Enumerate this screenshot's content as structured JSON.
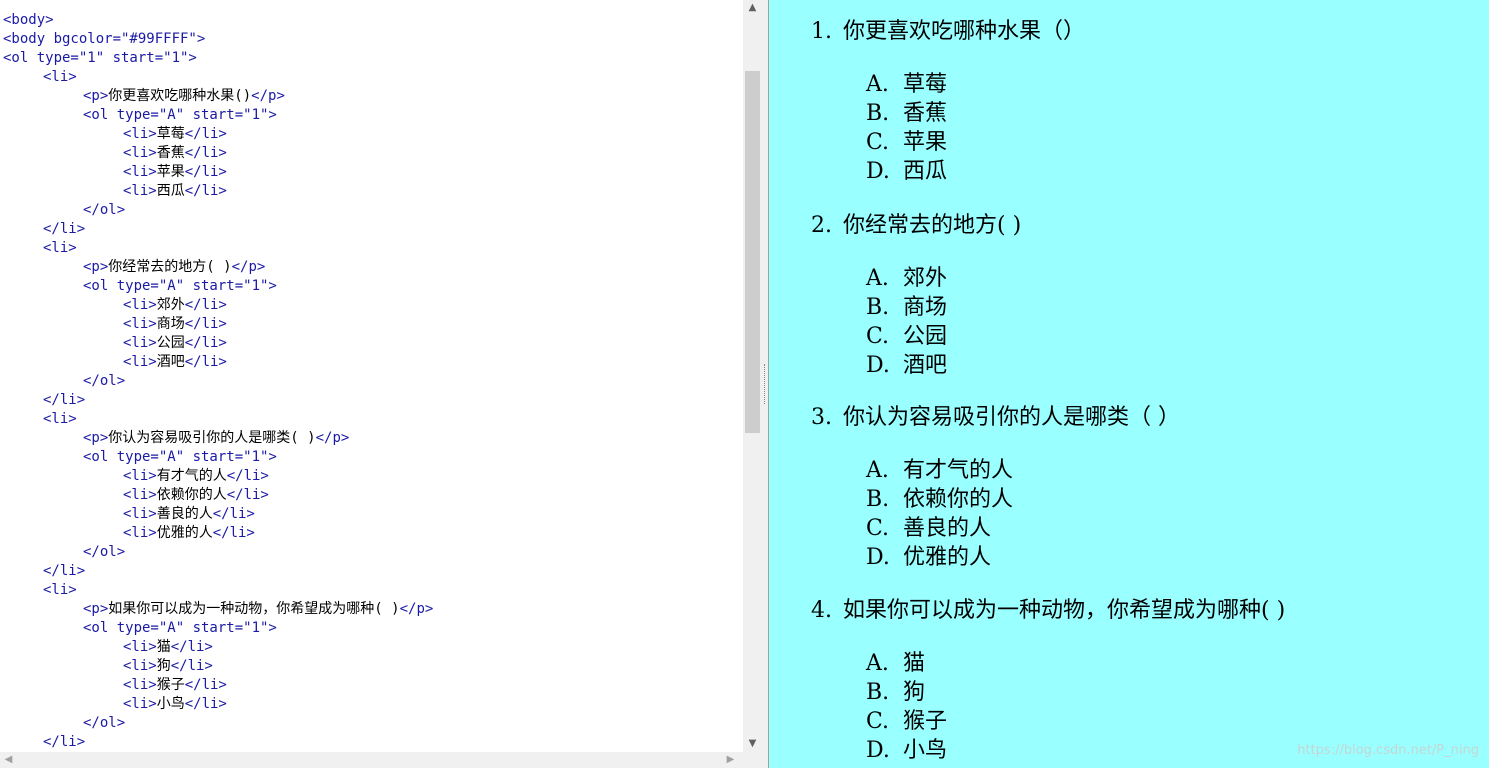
{
  "code": {
    "lines": [
      {
        "indent": 0,
        "text": "<body>"
      },
      {
        "indent": 0,
        "text": "<body bgcolor=\"#99FFFF\">"
      },
      {
        "indent": 0,
        "text": "<ol type=\"1\" start=\"1\">"
      },
      {
        "indent": 1,
        "text": "<li>"
      },
      {
        "indent": 2,
        "pre": "<p>",
        "content": "你更喜欢吃哪种水果()",
        "post": "</p>"
      },
      {
        "indent": 2,
        "text": "<ol type=\"A\" start=\"1\">"
      },
      {
        "indent": 3,
        "pre": "<li>",
        "content": "草莓",
        "post": "</li>"
      },
      {
        "indent": 3,
        "pre": "<li>",
        "content": "香蕉",
        "post": "</li>"
      },
      {
        "indent": 3,
        "pre": "<li>",
        "content": "苹果",
        "post": "</li>"
      },
      {
        "indent": 3,
        "pre": "<li>",
        "content": "西瓜",
        "post": "</li>"
      },
      {
        "indent": 2,
        "text": "</ol>"
      },
      {
        "indent": 1,
        "text": "</li>"
      },
      {
        "indent": 1,
        "text": "<li>"
      },
      {
        "indent": 2,
        "pre": "<p>",
        "content": "你经常去的地方( )",
        "post": "</p>"
      },
      {
        "indent": 2,
        "text": "<ol type=\"A\" start=\"1\">"
      },
      {
        "indent": 3,
        "pre": "<li>",
        "content": "郊外",
        "post": "</li>"
      },
      {
        "indent": 3,
        "pre": "<li>",
        "content": "商场",
        "post": "</li>"
      },
      {
        "indent": 3,
        "pre": "<li>",
        "content": "公园",
        "post": "</li>"
      },
      {
        "indent": 3,
        "pre": "<li>",
        "content": "酒吧",
        "post": "</li>"
      },
      {
        "indent": 2,
        "text": "</ol>"
      },
      {
        "indent": 1,
        "text": "</li>"
      },
      {
        "indent": 1,
        "text": "<li>"
      },
      {
        "indent": 2,
        "pre": "<p>",
        "content": "你认为容易吸引你的人是哪类( )",
        "post": "</p>"
      },
      {
        "indent": 2,
        "text": "<ol type=\"A\" start=\"1\">"
      },
      {
        "indent": 3,
        "pre": "<li>",
        "content": "有才气的人",
        "post": "</li>"
      },
      {
        "indent": 3,
        "pre": "<li>",
        "content": "依赖你的人",
        "post": "</li>"
      },
      {
        "indent": 3,
        "pre": "<li>",
        "content": "善良的人",
        "post": "</li>"
      },
      {
        "indent": 3,
        "pre": "<li>",
        "content": "优雅的人",
        "post": "</li>"
      },
      {
        "indent": 2,
        "text": "</ol>"
      },
      {
        "indent": 1,
        "text": "</li>"
      },
      {
        "indent": 1,
        "text": "<li>"
      },
      {
        "indent": 2,
        "pre": "<p>",
        "content": "如果你可以成为一种动物，你希望成为哪种( )",
        "post": "</p>"
      },
      {
        "indent": 2,
        "text": "<ol type=\"A\" start=\"1\">"
      },
      {
        "indent": 3,
        "pre": "<li>",
        "content": "猫",
        "post": "</li>"
      },
      {
        "indent": 3,
        "pre": "<li>",
        "content": "狗",
        "post": "</li>"
      },
      {
        "indent": 3,
        "pre": "<li>",
        "content": "猴子",
        "post": "</li>"
      },
      {
        "indent": 3,
        "pre": "<li>",
        "content": "小鸟",
        "post": "</li>"
      },
      {
        "indent": 2,
        "text": "</ol>"
      },
      {
        "indent": 1,
        "text": "</li>"
      }
    ]
  },
  "preview": {
    "background": "#99FFFF",
    "questions": [
      {
        "num": "1.",
        "text": "你更喜欢吃哪种水果（）",
        "options": [
          {
            "letter": "A.",
            "text": "草莓"
          },
          {
            "letter": "B.",
            "text": "香蕉"
          },
          {
            "letter": "C.",
            "text": "苹果"
          },
          {
            "letter": "D.",
            "text": "西瓜"
          }
        ]
      },
      {
        "num": "2.",
        "text": "你经常去的地方( )",
        "options": [
          {
            "letter": "A.",
            "text": "郊外"
          },
          {
            "letter": "B.",
            "text": "商场"
          },
          {
            "letter": "C.",
            "text": "公园"
          },
          {
            "letter": "D.",
            "text": "酒吧"
          }
        ]
      },
      {
        "num": "3.",
        "text": "你认为容易吸引你的人是哪类（ ）",
        "options": [
          {
            "letter": "A.",
            "text": "有才气的人"
          },
          {
            "letter": "B.",
            "text": "依赖你的人"
          },
          {
            "letter": "C.",
            "text": "善良的人"
          },
          {
            "letter": "D.",
            "text": "优雅的人"
          }
        ]
      },
      {
        "num": "4.",
        "text": "如果你可以成为一种动物，你希望成为哪种( )",
        "options": [
          {
            "letter": "A.",
            "text": "猫"
          },
          {
            "letter": "B.",
            "text": "狗"
          },
          {
            "letter": "C.",
            "text": "猴子"
          },
          {
            "letter": "D.",
            "text": "小鸟"
          }
        ]
      }
    ]
  },
  "watermark": "https://blog.csdn.net/P_ning",
  "icons": {
    "scroll_up": "▲",
    "scroll_down": "▼",
    "scroll_left": "◀",
    "scroll_right": "▶"
  }
}
